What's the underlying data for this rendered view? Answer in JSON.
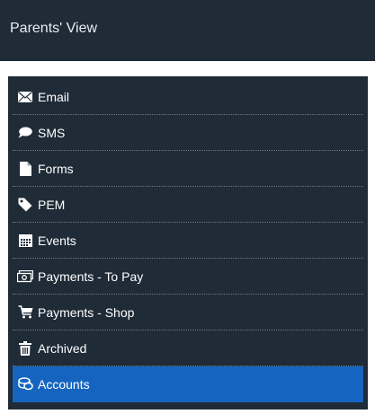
{
  "header": {
    "title": "Parents' View"
  },
  "menu": {
    "items": [
      {
        "label": "Email",
        "icon": "envelope-icon"
      },
      {
        "label": "SMS",
        "icon": "speech-bubble-icon"
      },
      {
        "label": "Forms",
        "icon": "document-icon"
      },
      {
        "label": "PEM",
        "icon": "tag-icon"
      },
      {
        "label": "Events",
        "icon": "calendar-icon"
      },
      {
        "label": "Payments - To Pay",
        "icon": "cash-icon"
      },
      {
        "label": "Payments - Shop",
        "icon": "shopping-cart-icon"
      },
      {
        "label": "Archived",
        "icon": "trash-icon"
      },
      {
        "label": "Accounts",
        "icon": "coins-icon"
      }
    ],
    "active": "Accounts"
  },
  "colors": {
    "header_bg": "#1f2b37",
    "menu_bg": "#1f2b37",
    "active_bg": "#1565c0",
    "text": "#ffffff"
  }
}
